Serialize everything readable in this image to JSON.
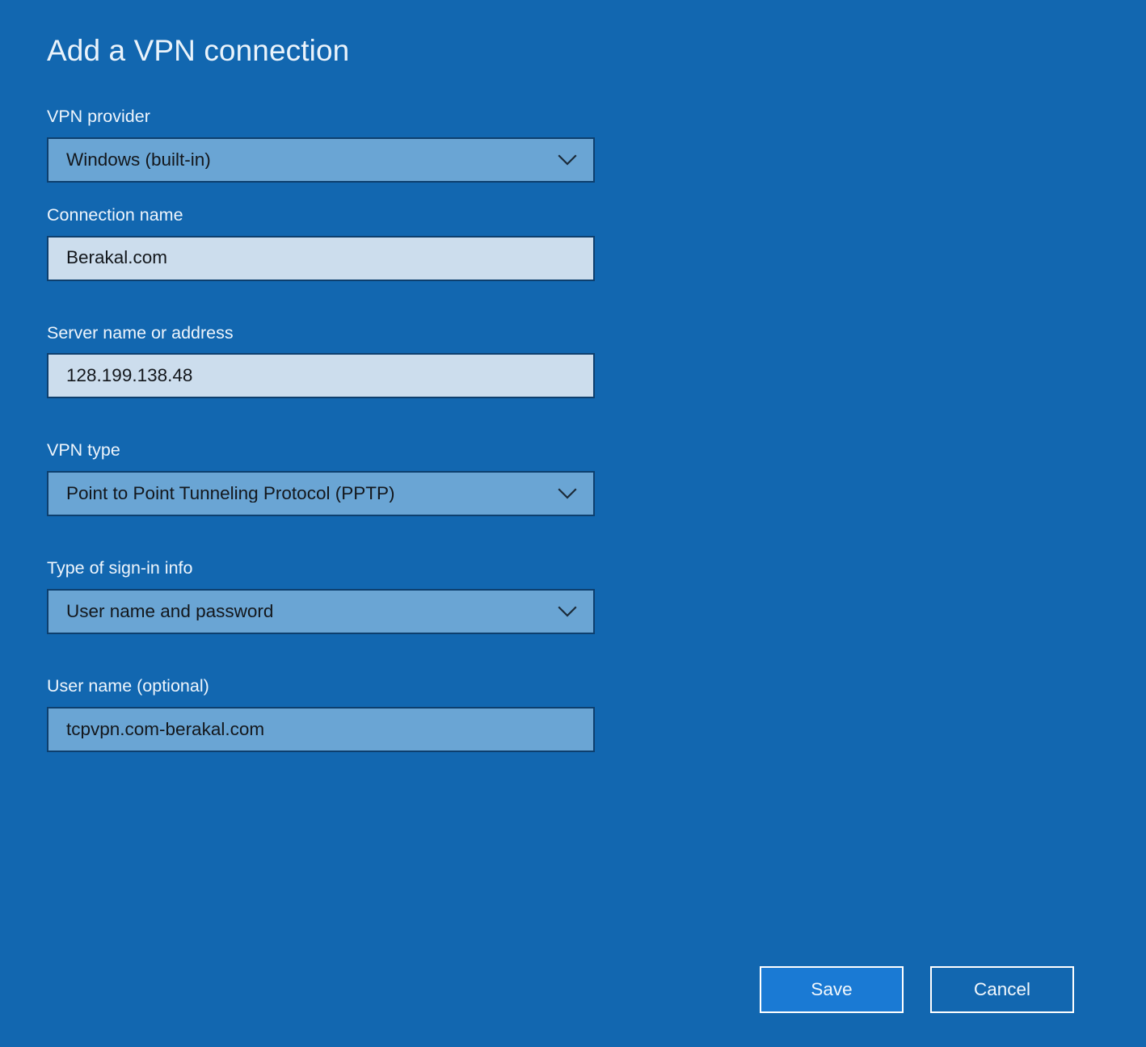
{
  "page": {
    "title": "Add a VPN connection",
    "background_color": "#1267b0",
    "accent_color": "#1a7ad4",
    "field_border_color": "#0d3f6e",
    "text_input_fill": "#ccdded",
    "select_fill": "#6aa5d4"
  },
  "form": {
    "fields": [
      {
        "label": "VPN provider",
        "value": "Windows (built-in)",
        "control": "select",
        "icon": "chevron-down-icon",
        "name": "vpn-provider"
      },
      {
        "label": "Connection name",
        "value": "Berakal.com",
        "placeholder": "",
        "control": "text",
        "name": "connection-name"
      },
      {
        "label": "Server name or address",
        "value": "128.199.138.48",
        "placeholder": "",
        "control": "text",
        "name": "server-name"
      },
      {
        "label": "VPN type",
        "value": "Point to Point Tunneling Protocol (PPTP)",
        "control": "select",
        "icon": "chevron-down-icon",
        "name": "vpn-type"
      },
      {
        "label": "Type of sign-in info",
        "value": "User name and password",
        "control": "select",
        "icon": "chevron-down-icon",
        "name": "sign-in-info-type"
      },
      {
        "label": "User name (optional)",
        "value": "tcpvpn.com-berakal.com",
        "placeholder": "",
        "control": "steel",
        "name": "user-name"
      }
    ]
  },
  "buttons": {
    "save_label": "Save",
    "cancel_label": "Cancel"
  }
}
